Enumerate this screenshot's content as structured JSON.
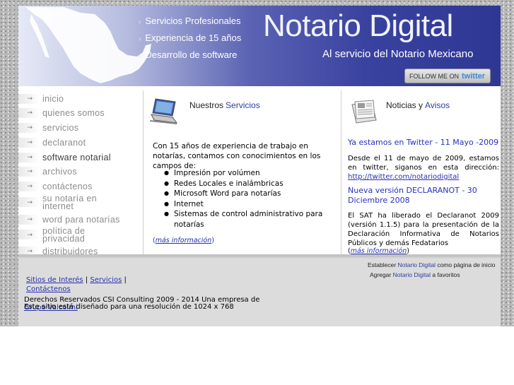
{
  "header": {
    "features": [
      "Servicios Profesionales",
      "Experiencia de 15 años",
      "Desarrollo de software"
    ],
    "title": "Notario Digital",
    "subtitle": "Al servicio del Notario Mexicano",
    "twitter_prefix": "FOLLOW ME ON",
    "twitter_brand": "twitter"
  },
  "sidebar": {
    "items": [
      {
        "label": "inicio"
      },
      {
        "label": "quienes somos"
      },
      {
        "label": "servicios"
      },
      {
        "label": "declaranot"
      },
      {
        "label": "software notarial"
      },
      {
        "label": "archivos"
      },
      {
        "label": "contáctenos"
      },
      {
        "label": "su notaría en internet"
      },
      {
        "label": "word para notarías"
      },
      {
        "label": "política de privacidad"
      },
      {
        "label": "distribuidores"
      }
    ]
  },
  "services": {
    "heading_plain": "Nuestros",
    "heading_accent": "Servicios",
    "intro": "Con 15 años de experiencia de trabajo en notarías, contamos con conocimientos en los campos de:",
    "list": [
      "Impresión por volúmen",
      "Redes Locales e inalámbricas",
      "Microsoft Word para notarías",
      "Internet",
      "Sistemas de control administrativo para notarías"
    ],
    "more_open": "(",
    "more_link": "más información",
    "more_close": ")"
  },
  "news": {
    "heading_plain": "Noticias y",
    "heading_accent": "Avisos",
    "items": [
      {
        "title": "Ya estamos en Twitter - 11 Mayo -2009",
        "body": "Desde el 11 de mayo de 2009, estamos en twitter, siganos en esta dirección:",
        "link": "http://twitter.com/notariodigital"
      },
      {
        "title": "Nueva versión DECLARANOT - 30 Diciembre 2008",
        "body": "El SAT ha liberado el Declaranot 2009 (versión 1.1.5) para la presentación de la Declaración Informativa de Notarios Públicos y demás Fedatarios"
      }
    ],
    "more_open": "(",
    "more_link": "más información",
    "more_close": ")"
  },
  "footer": {
    "set_home_prefix": "Establecer",
    "set_home_brand": "Notario Digital",
    "set_home_suffix": "como página de inicio",
    "set_fav_prefix": "Agregar",
    "set_fav_brand": "Notario Digital",
    "set_fav_suffix": "a favoritos",
    "links": [
      "Sitios de Interés",
      "Servicios",
      "Contáctenos"
    ],
    "link_sep": "|",
    "copyright": "Derechos Reservados CSI Consulting 2009 - 2014 Una empresa de",
    "copyright_link": "Grupo Valcolmi",
    "resolution_note": "Este sitio está diseñado para una resolución de 1024 x 768"
  },
  "colors": {
    "accent": "#2a3ea0",
    "link": "#2530b0",
    "banner_dark": "#2e3793"
  }
}
